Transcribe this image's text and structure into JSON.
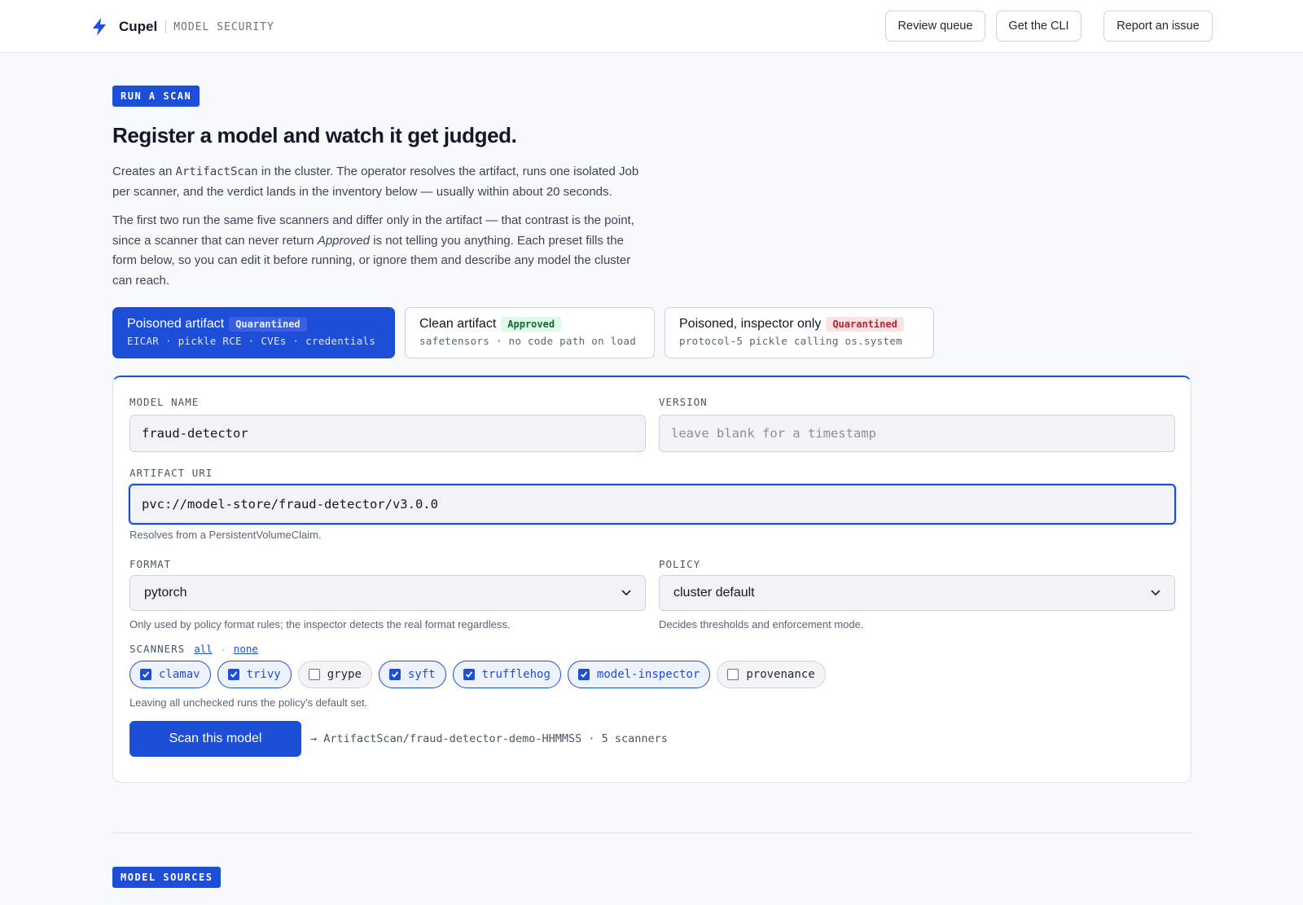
{
  "header": {
    "brand": "Cupel",
    "subtitle": "MODEL SECURITY",
    "buttons": {
      "review_queue": "Review queue",
      "get_cli": "Get the CLI",
      "report_issue": "Report an issue"
    }
  },
  "section": {
    "tag": "RUN A SCAN",
    "title": "Register a model and watch it get judged.",
    "intro1_before": "Creates an ",
    "intro1_code": "ArtifactScan",
    "intro1_after": " in the cluster. The operator resolves the artifact, runs one isolated Job per scanner, and the verdict lands in the inventory below — usually within about 20 seconds.",
    "intro2_before": "The first two run the same five scanners and differ only in the artifact — that contrast is the point, since a scanner that can never return ",
    "intro2_em": "Approved",
    "intro2_after": " is not telling you anything. Each preset fills the form below, so you can edit it before running, or ignore them and describe any model the cluster can reach."
  },
  "presets": [
    {
      "title": "Poisoned artifact",
      "badge": "Quarantined",
      "sub": "EICAR · pickle RCE · CVEs · credentials",
      "active": true
    },
    {
      "title": "Clean artifact",
      "badge": "Approved",
      "sub": "safetensors · no code path on load",
      "active": false
    },
    {
      "title": "Poisoned, inspector only",
      "badge": "Quarantined",
      "sub": "protocol-5 pickle calling os.system",
      "active": false
    }
  ],
  "form": {
    "model_name": {
      "label": "MODEL NAME",
      "value": "fraud-detector"
    },
    "version": {
      "label": "VERSION",
      "placeholder": "leave blank for a timestamp"
    },
    "artifact_uri": {
      "label": "ARTIFACT URI",
      "value": "pvc://model-store/fraud-detector/v3.0.0",
      "hint": "Resolves from a PersistentVolumeClaim."
    },
    "format": {
      "label": "FORMAT",
      "value": "pytorch",
      "hint": "Only used by policy format rules; the inspector detects the real format regardless."
    },
    "policy": {
      "label": "POLICY",
      "value": "cluster default",
      "hint": "Decides thresholds and enforcement mode."
    },
    "scanners": {
      "label": "SCANNERS",
      "all": "all",
      "sep": "·",
      "none": "none",
      "items": [
        {
          "name": "clamav",
          "checked": true
        },
        {
          "name": "trivy",
          "checked": true
        },
        {
          "name": "grype",
          "checked": false
        },
        {
          "name": "syft",
          "checked": true
        },
        {
          "name": "trufflehog",
          "checked": true
        },
        {
          "name": "model-inspector",
          "checked": true
        },
        {
          "name": "provenance",
          "checked": false
        }
      ],
      "hint": "Leaving all unchecked runs the policy's default set."
    },
    "submit": "Scan this model",
    "preview": "→ ArtifactScan/fraud-detector-demo-HHMMSS · 5 scanners"
  },
  "next_section": {
    "tag": "MODEL SOURCES"
  },
  "colors": {
    "accent": "#1d4ed8",
    "approved": "#166534",
    "quarantined": "#b4233a"
  }
}
